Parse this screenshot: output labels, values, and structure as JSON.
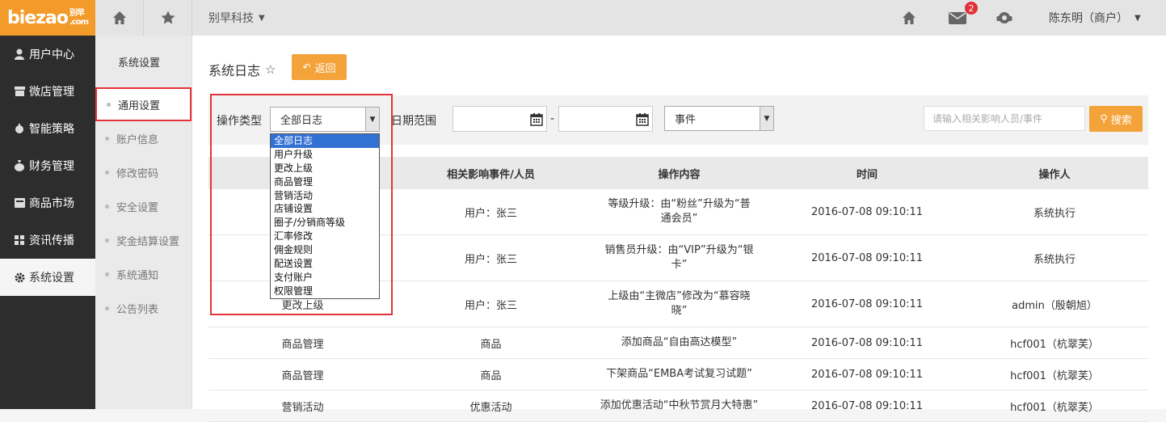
{
  "logo": {
    "main": "biezao",
    "side1": "别早",
    "side2": ".com"
  },
  "topbar": {
    "company": "别早科技",
    "mail_badge": "2",
    "user": "陈东明（商户）"
  },
  "leftnav": [
    {
      "label": "用户中心",
      "icon": "user-icon"
    },
    {
      "label": "微店管理",
      "icon": "shop-icon"
    },
    {
      "label": "智能策略",
      "icon": "strategy-icon"
    },
    {
      "label": "财务管理",
      "icon": "money-bag-icon"
    },
    {
      "label": "商品市场",
      "icon": "market-icon"
    },
    {
      "label": "资讯传播",
      "icon": "grid-icon"
    },
    {
      "label": "系统设置",
      "icon": "gear-icon",
      "active": true
    }
  ],
  "subnav": {
    "title": "系统设置",
    "items": [
      "通用设置",
      "账户信息",
      "修改密码",
      "安全设置",
      "奖金结算设置",
      "系统通知",
      "公告列表"
    ]
  },
  "page": {
    "title": "系统日志",
    "back": "返回"
  },
  "filter": {
    "op_type_label": "操作类型",
    "op_type_value": "全部日志",
    "date_label": "日期范围",
    "date_sep": "-",
    "event_value": "事件",
    "search_placeholder": "请输入相关影响人员/事件",
    "search_btn": "搜索"
  },
  "dropdown": [
    "全部日志",
    "用户升级",
    "更改上级",
    "商品管理",
    "营销活动",
    "店铺设置",
    "圈子/分销商等级",
    "汇率修改",
    "佣金规则",
    "配送设置",
    "支付账户",
    "权限管理"
  ],
  "table": {
    "headers": [
      "",
      "相关影响事件/人员",
      "操作内容",
      "时间",
      "操作人"
    ],
    "rows": [
      {
        "type": "",
        "target": "用户：张三",
        "content": "等级升级：由“粉丝”升级为“普通会员”",
        "time": "2016-07-08 09:10:11",
        "operator": "系统执行"
      },
      {
        "type": "",
        "target": "用户：张三",
        "content": "销售员升级：由“VIP”升级为“银卡”",
        "time": "2016-07-08 09:10:11",
        "operator": "系统执行"
      },
      {
        "type": "更改上级",
        "target": "用户：张三",
        "content": "上级由“主微店”修改为“慕容晓晓”",
        "time": "2016-07-08 09:10:11",
        "operator": "admin（殷朝旭）"
      },
      {
        "type": "商品管理",
        "target": "商品",
        "content": "添加商品“自由高达模型”",
        "time": "2016-07-08 09:10:11",
        "operator": "hcf001（杭翠芙）"
      },
      {
        "type": "商品管理",
        "target": "商品",
        "content": "下架商品“EMBA考试复习试题”",
        "time": "2016-07-08 09:10:11",
        "operator": "hcf001（杭翠芙）"
      },
      {
        "type": "营销活动",
        "target": "优惠活动",
        "content": "添加优惠活动“中秋节赏月大特惠”",
        "time": "2016-07-08 09:10:11",
        "operator": "hcf001（杭翠芙）"
      }
    ]
  },
  "colors": {
    "accent": "#f3a33a",
    "logo_bg": "#f39b2a",
    "nav_bg": "#2d2d2d",
    "highlight_box": "#e53338",
    "dropdown_selected": "#3271d4"
  }
}
